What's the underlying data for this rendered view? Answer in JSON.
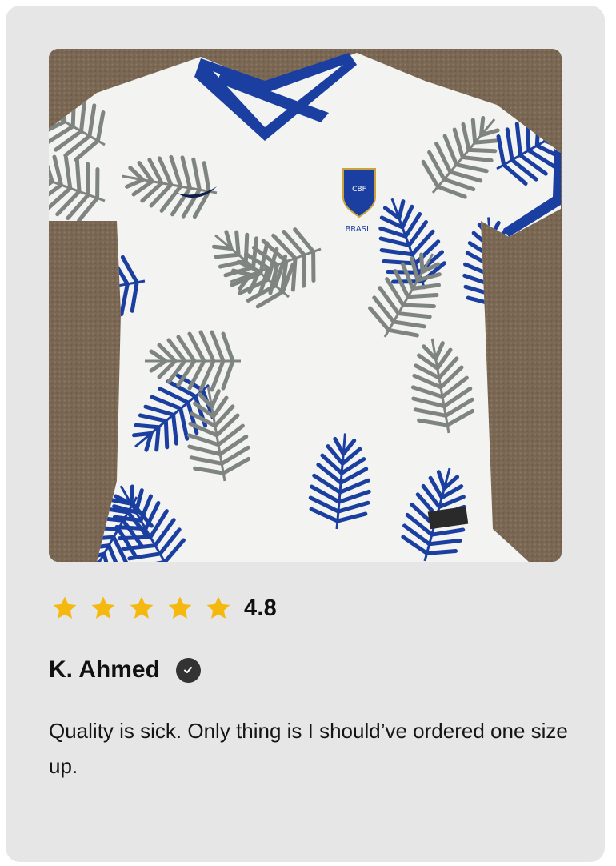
{
  "review": {
    "photo_alt": "white jersey with blue and grey palm leaf print",
    "rating": {
      "stars_filled": 5,
      "stars_total": 5,
      "value_text": "4.8"
    },
    "reviewer": {
      "name": "K. Ahmed",
      "verified": true
    },
    "text": "Quality is sick. Only thing is I should’ve ordered one size up."
  },
  "colors": {
    "card_background": "#e6e6e6",
    "star": "#f5b80f",
    "text": "#111111",
    "verified_badge": "#333333",
    "jersey_blue": "#1a3fa0",
    "jersey_grey": "#8a8f8c",
    "carpet": "#7d6a57"
  }
}
